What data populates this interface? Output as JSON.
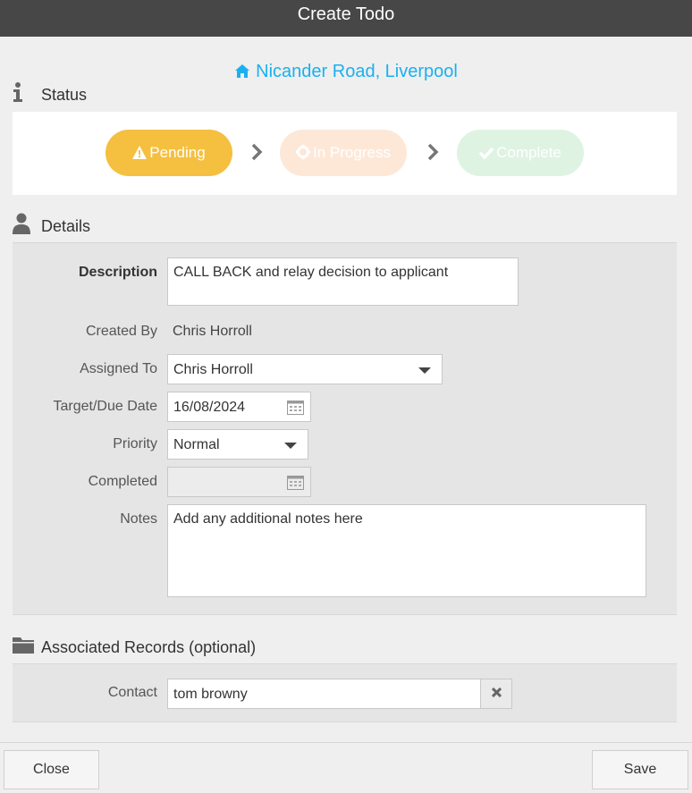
{
  "dialog": {
    "title": "Create Todo"
  },
  "property": {
    "address": "Nicander Road, Liverpool",
    "icon": "house-icon",
    "color": "#1ab0f0"
  },
  "status_section": {
    "heading": "Status",
    "icon": "info-icon",
    "steps": [
      {
        "label": "Pending",
        "icon": "warning-icon",
        "active": true,
        "color": "#f5bf3f"
      },
      {
        "label": "In Progress",
        "icon": "cog-icon",
        "active": false,
        "color": "#fde8d8"
      },
      {
        "label": "Complete",
        "icon": "check-icon",
        "active": false,
        "color": "#dff3e2"
      }
    ]
  },
  "details_section": {
    "heading": "Details",
    "icon": "user-icon",
    "description": {
      "label": "Description",
      "value": "CALL BACK and relay decision to applicant"
    },
    "created_by": {
      "label": "Created By",
      "value": "Chris Horroll"
    },
    "assigned_to": {
      "label": "Assigned To",
      "value": "Chris Horroll"
    },
    "target_date": {
      "label": "Target/Due Date",
      "value": "16/08/2024"
    },
    "priority": {
      "label": "Priority",
      "value": "Normal"
    },
    "completed": {
      "label": "Completed",
      "value": ""
    },
    "notes": {
      "label": "Notes",
      "placeholder": "Add any additional notes here"
    }
  },
  "associated_section": {
    "heading": "Associated Records (optional)",
    "icon": "folder-icon",
    "contact": {
      "label": "Contact",
      "value": "tom browny"
    }
  },
  "footer": {
    "close_label": "Close",
    "save_label": "Save"
  }
}
